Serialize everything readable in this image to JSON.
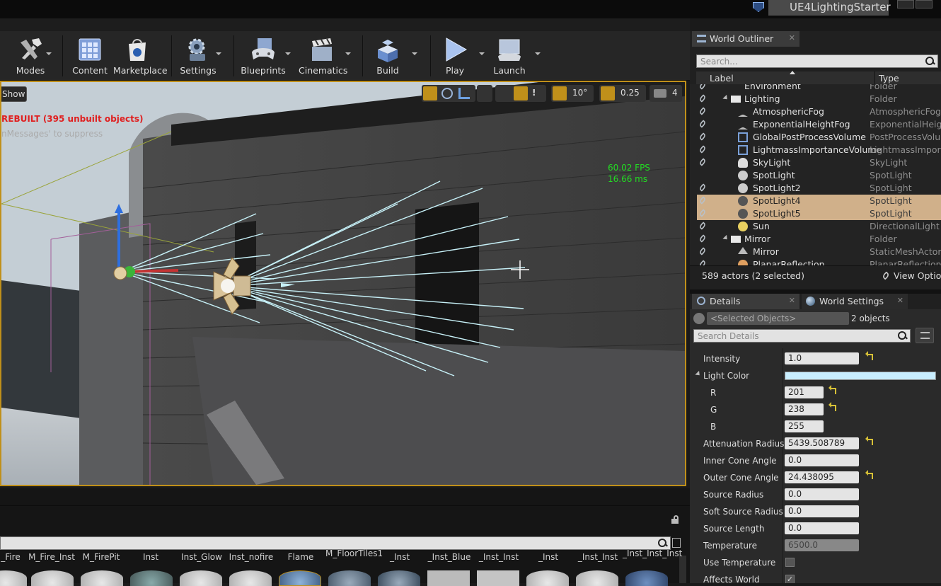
{
  "window": {
    "project_name": "UE4LightingStarter"
  },
  "toolbar": {
    "modes": "Modes",
    "content": "Content",
    "marketplace": "Marketplace",
    "settings": "Settings",
    "blueprints": "Blueprints",
    "cinematics": "Cinematics",
    "build": "Build",
    "play": "Play",
    "launch": "Launch"
  },
  "viewport": {
    "show_button": "Show",
    "warning": "REBUILT (395 unbuilt objects)",
    "warning_sub": "nMessages' to suppress",
    "fps": "60.02 FPS",
    "ms": "16.66 ms",
    "rotation_snap": "10°",
    "scale_snap": "0.25",
    "camera_speed": "4"
  },
  "outliner": {
    "tab": "World Outliner",
    "search_placeholder": "Search...",
    "col_label": "Label",
    "col_type": "Type",
    "rows": [
      {
        "label": "Environment",
        "type": "Folder"
      },
      {
        "label": "Lighting",
        "type": "Folder"
      },
      {
        "label": "AtmosphericFog",
        "type": "AtmosphericFog"
      },
      {
        "label": "ExponentialHeightFog",
        "type": "ExponentialHeig"
      },
      {
        "label": "GlobalPostProcessVolume",
        "type": "PostProcessVolu"
      },
      {
        "label": "LightmassImportanceVolume",
        "type": "LightmassImport"
      },
      {
        "label": "SkyLight",
        "type": "SkyLight"
      },
      {
        "label": "SpotLight",
        "type": "SpotLight"
      },
      {
        "label": "SpotLight2",
        "type": "SpotLight"
      },
      {
        "label": "SpotLight4",
        "type": "SpotLight"
      },
      {
        "label": "SpotLight5",
        "type": "SpotLight"
      },
      {
        "label": "Sun",
        "type": "DirectionalLight"
      },
      {
        "label": "Mirror",
        "type": "Folder"
      },
      {
        "label": "Mirror",
        "type": "StaticMeshActor"
      },
      {
        "label": "PlanarReflection",
        "type": "PlanarReflection"
      }
    ],
    "status": "589 actors (2 selected)",
    "view_options": "View Option"
  },
  "details": {
    "tab": "Details",
    "world_settings_tab": "World Settings",
    "selected_placeholder": "<Selected Objects>",
    "selected_count": "2 objects",
    "search_placeholder": "Search Details",
    "intensity_label": "Intensity",
    "intensity": "1.0",
    "light_color_label": "Light Color",
    "r_label": "R",
    "r": "201",
    "g_label": "G",
    "g": "238",
    "b_label": "B",
    "b": "255",
    "atten_label": "Attenuation Radius",
    "atten": "5439.508789",
    "inner_label": "Inner Cone Angle",
    "inner": "0.0",
    "outer_label": "Outer Cone Angle",
    "outer": "24.438095",
    "src_radius_label": "Source Radius",
    "src_radius": "0.0",
    "soft_radius_label": "Soft Source Radius",
    "soft_radius": "0.0",
    "src_len_label": "Source Length",
    "src_len": "0.0",
    "temp_label": "Temperature",
    "temp": "6500.0",
    "use_temp_label": "Use Temperature",
    "affects_label": "Affects World"
  },
  "content": {
    "labels": [
      "_Fire",
      "M_Fire_Inst",
      "M_FirePit",
      "Inst",
      "Inst_Glow",
      "Inst_nofire",
      "Flame",
      "M_FloorTiles1",
      "_Inst",
      "_Inst_Blue",
      "_Inst_Inst",
      "_Inst",
      "_Inst_Inst",
      "_Inst_Inst_Inst"
    ]
  },
  "colors": {
    "accent": "#c0901a",
    "selection": "#d0b08a",
    "light_color": "#c9eeff",
    "warning": "#e02020",
    "fps": "#22dd22"
  }
}
